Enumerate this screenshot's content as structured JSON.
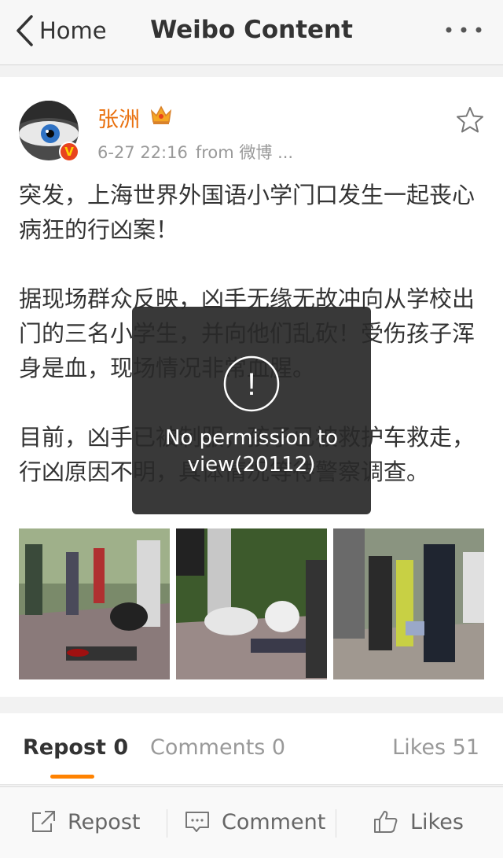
{
  "nav": {
    "back_label": "Home",
    "title": "Weibo Content"
  },
  "post": {
    "username": "张洲",
    "timestamp": "6-27 22:16",
    "source": "from 微博 ...",
    "paragraphs": [
      "突发，上海世界外国语小学门口发生一起丧心病狂的行凶案！",
      "据现场群众反映，凶手无缘无故冲向从学校出门的三名小学生，并向他们乱砍！受伤孩子浑身是血，现场情况非常血腥。",
      "目前，凶手已被制服，孩子已被救护车救走，行凶原因不明，具体情况等待警察调查。"
    ],
    "verified_badge": "V"
  },
  "tabs": {
    "repost": "Repost 0",
    "comments": "Comments 0",
    "likes": "Likes 51"
  },
  "actions": {
    "repost": "Repost",
    "comment": "Comment",
    "likes": "Likes"
  },
  "toast": {
    "message": "No permission to view(20112)",
    "icon": "!"
  },
  "colors": {
    "username": "#e9700e",
    "tab_underline": "#ff8200",
    "verified_badge": "#e8431d"
  },
  "icons": [
    "back-chevron-icon",
    "more-dots-icon",
    "crown-icon",
    "star-icon",
    "repost-icon",
    "comment-icon",
    "thumbs-up-icon",
    "exclamation-icon"
  ]
}
